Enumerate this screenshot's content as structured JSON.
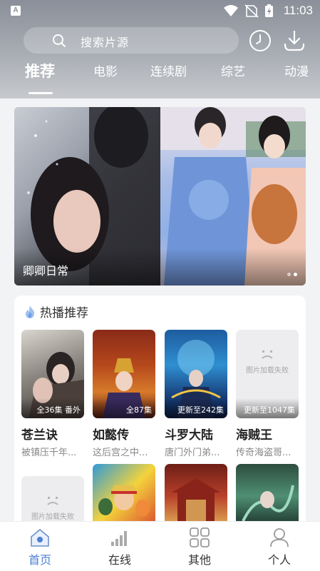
{
  "status_bar": {
    "time": "11:03",
    "app_badge": "A"
  },
  "search": {
    "placeholder": "搜索片源"
  },
  "tabs": [
    {
      "label": "推荐",
      "active": true
    },
    {
      "label": "电影"
    },
    {
      "label": "连续剧"
    },
    {
      "label": "综艺"
    },
    {
      "label": "动漫"
    }
  ],
  "banner": {
    "title": "卿卿日常",
    "page_count": 2,
    "current_page": 2
  },
  "section": {
    "title": "热播推荐",
    "items": [
      {
        "title": "苍兰诀",
        "desc": "被镇压千年...",
        "episodes": "全36集 番外",
        "image_failed": false
      },
      {
        "title": "如懿传",
        "desc": "这后宫之中...",
        "episodes": "全87集",
        "image_failed": false
      },
      {
        "title": "斗罗大陆",
        "desc": "唐门外门弟...",
        "episodes": "更新至242集",
        "image_failed": false
      },
      {
        "title": "海贼王",
        "desc": "传奇海盗哥...",
        "episodes": "更新至1047集",
        "image_failed": true
      }
    ],
    "second_row": [
      {
        "image_failed": true
      },
      {
        "image_failed": false
      },
      {
        "image_failed": false
      },
      {
        "image_failed": false
      }
    ]
  },
  "image_fail_text": "图片加载失败",
  "bottom_nav": [
    {
      "label": "首页",
      "icon": "home-icon",
      "active": true
    },
    {
      "label": "在线",
      "icon": "signal-bars-icon"
    },
    {
      "label": "其他",
      "icon": "grid-icon"
    },
    {
      "label": "个人",
      "icon": "person-icon"
    }
  ],
  "colors": {
    "accent": "#4a7fd6",
    "header_top": "#8a8f99",
    "header_bottom": "#c7c9cd"
  }
}
